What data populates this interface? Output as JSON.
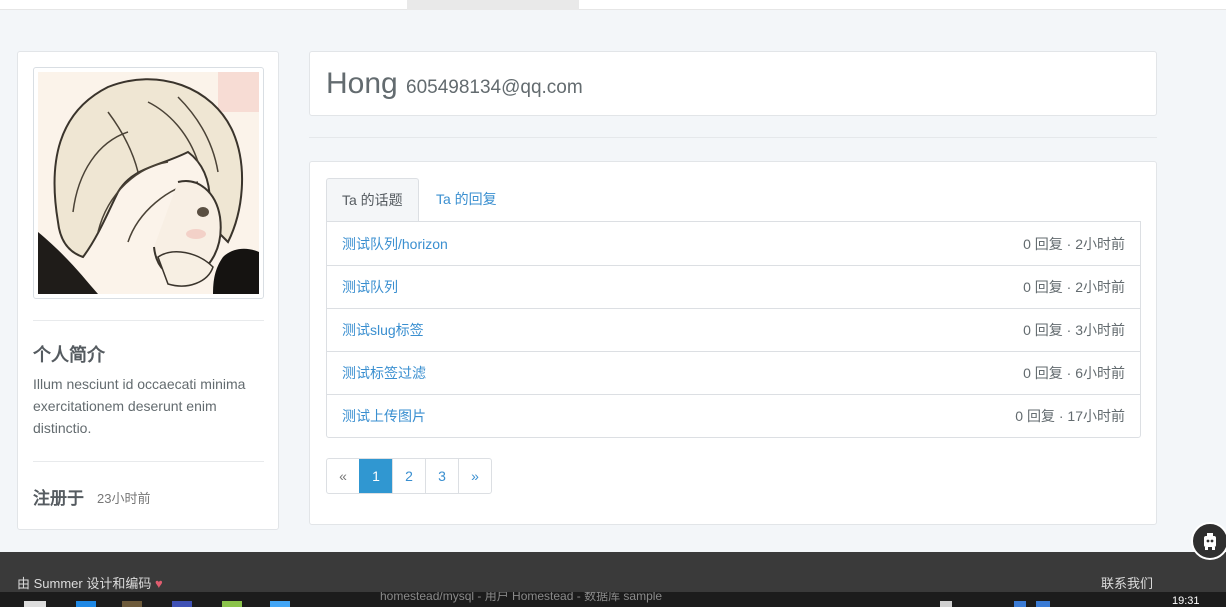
{
  "profile": {
    "intro_title": "个人简介",
    "intro_text": "Illum nesciunt id occaecati minima exercitationem deserunt enim distinctio.",
    "registered_label": "注册于",
    "registered_value": "23小时前"
  },
  "header": {
    "name": "Hong",
    "email": "605498134@qq.com"
  },
  "tabs": [
    {
      "label": "Ta 的话题",
      "active": true
    },
    {
      "label": "Ta 的回复",
      "active": false
    }
  ],
  "topics": [
    {
      "title": "测试队列/horizon",
      "meta": "0 回复 · 2小时前"
    },
    {
      "title": "测试队列",
      "meta": "0 回复 · 2小时前"
    },
    {
      "title": "测试slug标签",
      "meta": "0 回复 · 3小时前"
    },
    {
      "title": "测试标签过滤",
      "meta": "0 回复 · 6小时前"
    },
    {
      "title": "测试上传图片",
      "meta": "0 回复 · 17小时前"
    }
  ],
  "pagination": {
    "prev": "«",
    "pages": [
      "1",
      "2",
      "3"
    ],
    "current": "1",
    "next": "»"
  },
  "footer": {
    "credit": "由 Summer 设计和编码",
    "heart": "♥",
    "contact": "联系我们"
  },
  "taskbar": {
    "window_title": "homestead/mysql - 用户 Homestead - 数据库 sample",
    "clock": "19:31"
  },
  "colors": {
    "link": "#3a8fd0",
    "page_active": "#3097d1",
    "footer_bg": "#3a3a3a",
    "heart": "#e05d6f"
  }
}
